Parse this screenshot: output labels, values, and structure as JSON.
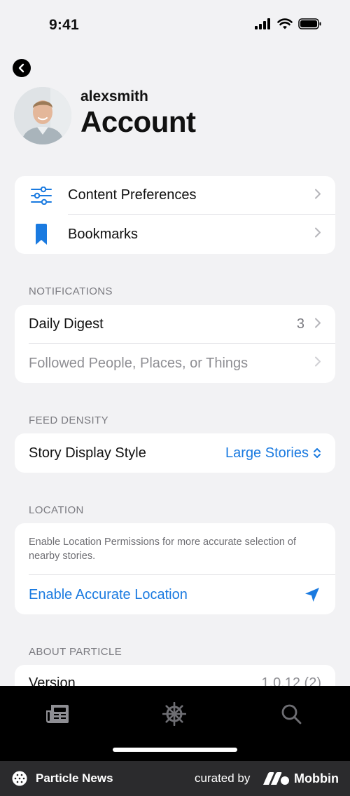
{
  "status": {
    "time": "9:41"
  },
  "profile": {
    "username": "alexsmith",
    "title": "Account"
  },
  "menu": [
    {
      "label": "Content Preferences",
      "icon": "sliders-icon"
    },
    {
      "label": "Bookmarks",
      "icon": "bookmark-icon"
    }
  ],
  "notifications": {
    "header": "NOTIFICATIONS",
    "daily_digest": {
      "label": "Daily Digest",
      "value": "3"
    },
    "followed": {
      "label": "Followed People, Places, or Things"
    }
  },
  "feed_density": {
    "header": "FEED DENSITY",
    "label": "Story Display Style",
    "value": "Large Stories"
  },
  "location": {
    "header": "LOCATION",
    "description": "Enable Location Permissions for more accurate selection of nearby stories.",
    "action": "Enable Accurate Location"
  },
  "about": {
    "header": "ABOUT PARTICLE",
    "version_label": "Version",
    "version_value": "1.0.12 (2)"
  },
  "tabbar": {
    "tabs": [
      "news-icon",
      "helm-icon",
      "search-icon"
    ]
  },
  "footer": {
    "app_name": "Particle News",
    "curated_by": "curated by",
    "brand": "Mobbin"
  },
  "colors": {
    "accent": "#1a7ae0",
    "background": "#f2f2f4",
    "card": "#ffffff",
    "muted": "#7a7a80"
  }
}
